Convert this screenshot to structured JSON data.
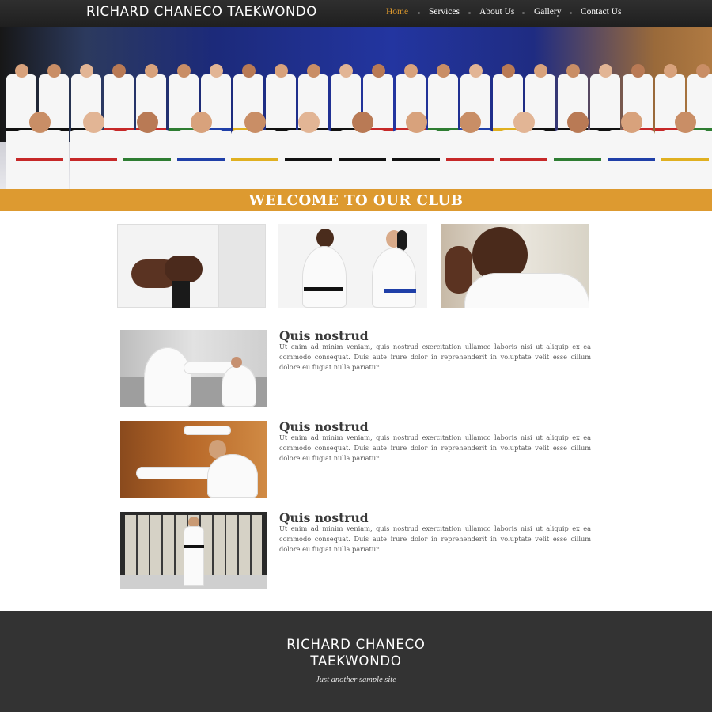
{
  "header": {
    "brand": "RICHARD CHANECO TAEKWONDO",
    "nav": [
      {
        "label": "Home",
        "active": true
      },
      {
        "label": "Services",
        "active": false
      },
      {
        "label": "About Us",
        "active": false
      },
      {
        "label": "Gallery",
        "active": false
      },
      {
        "label": "Contact Us",
        "active": false
      }
    ]
  },
  "hero": {
    "banner": "WELCOME TO OUR CLUB"
  },
  "articles": [
    {
      "title": "Quis nostrud",
      "body": "Ut enim ad minim veniam, quis nostrud exercitation ullamco laboris nisi ut aliquip ex ea commodo consequat. Duis aute irure dolor in reprehenderit in voluptate velit esse cillum dolore eu fugiat nulla pariatur."
    },
    {
      "title": "Quis nostrud",
      "body": "Ut enim ad minim veniam, quis nostrud exercitation ullamco laboris nisi ut aliquip ex ea commodo consequat. Duis aute irure dolor in reprehenderit in voluptate velit esse cillum dolore eu fugiat nulla pariatur."
    },
    {
      "title": "Quis nostrud",
      "body": "Ut enim ad minim veniam, quis nostrud exercitation ullamco laboris nisi ut aliquip ex ea commodo consequat. Duis aute irure dolor in reprehenderit in voluptate velit esse cillum dolore eu fugiat nulla pariatur."
    }
  ],
  "footer": {
    "brand_line1": "RICHARD CHANECO",
    "brand_line2": "TAEKWONDO",
    "tagline": "Just another sample site"
  },
  "colors": {
    "accent": "#dd9a30",
    "header_bg": "#262626",
    "footer_bg": "#333333"
  }
}
